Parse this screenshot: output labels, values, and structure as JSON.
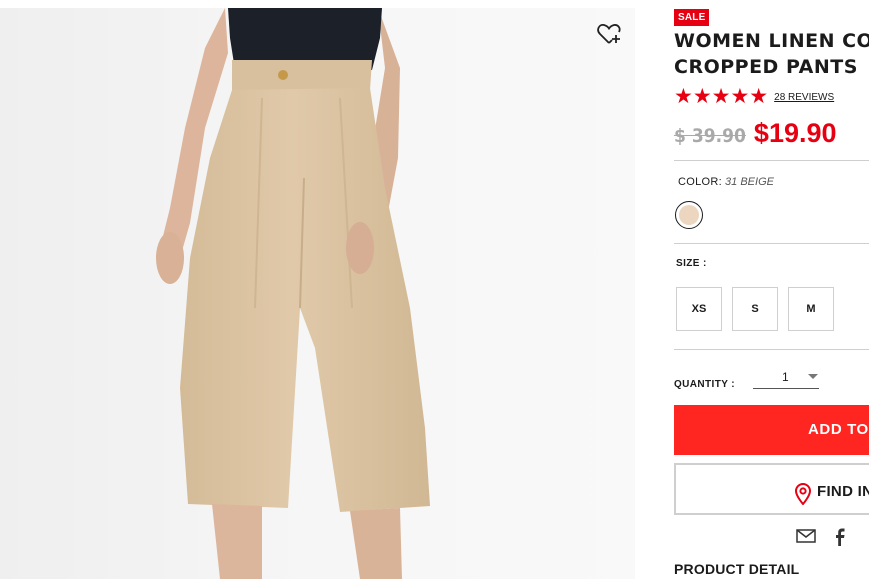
{
  "product": {
    "sale_badge": "SALE",
    "title": "WOMEN LINEN COTT\nCROPPED PANTS",
    "rating_stars": "★★★★★",
    "reviews": "28 REVIEWS",
    "old_price": "$ 39.90",
    "new_price": "$19.90",
    "color_label": "COLOR:",
    "color_value": "31 BEIGE",
    "size_label": "SIZE :",
    "sizes": [
      "XS",
      "S",
      "M"
    ],
    "quantity_label": "QUANTITY :",
    "quantity_value": "1",
    "add_to_cart": "ADD TO",
    "find_in_store": "FIND IN",
    "product_detail": "PRODUCT DETAIL"
  },
  "icons": {
    "wishlist": "heart-plus-icon",
    "location": "map-pin-icon",
    "email": "envelope-icon",
    "facebook": "facebook-icon"
  },
  "colors": {
    "sale_red": "#e60012",
    "button_red": "#ff2520",
    "swatch_beige": "#ecd6c0",
    "pants_beige": "#dac2a2"
  }
}
